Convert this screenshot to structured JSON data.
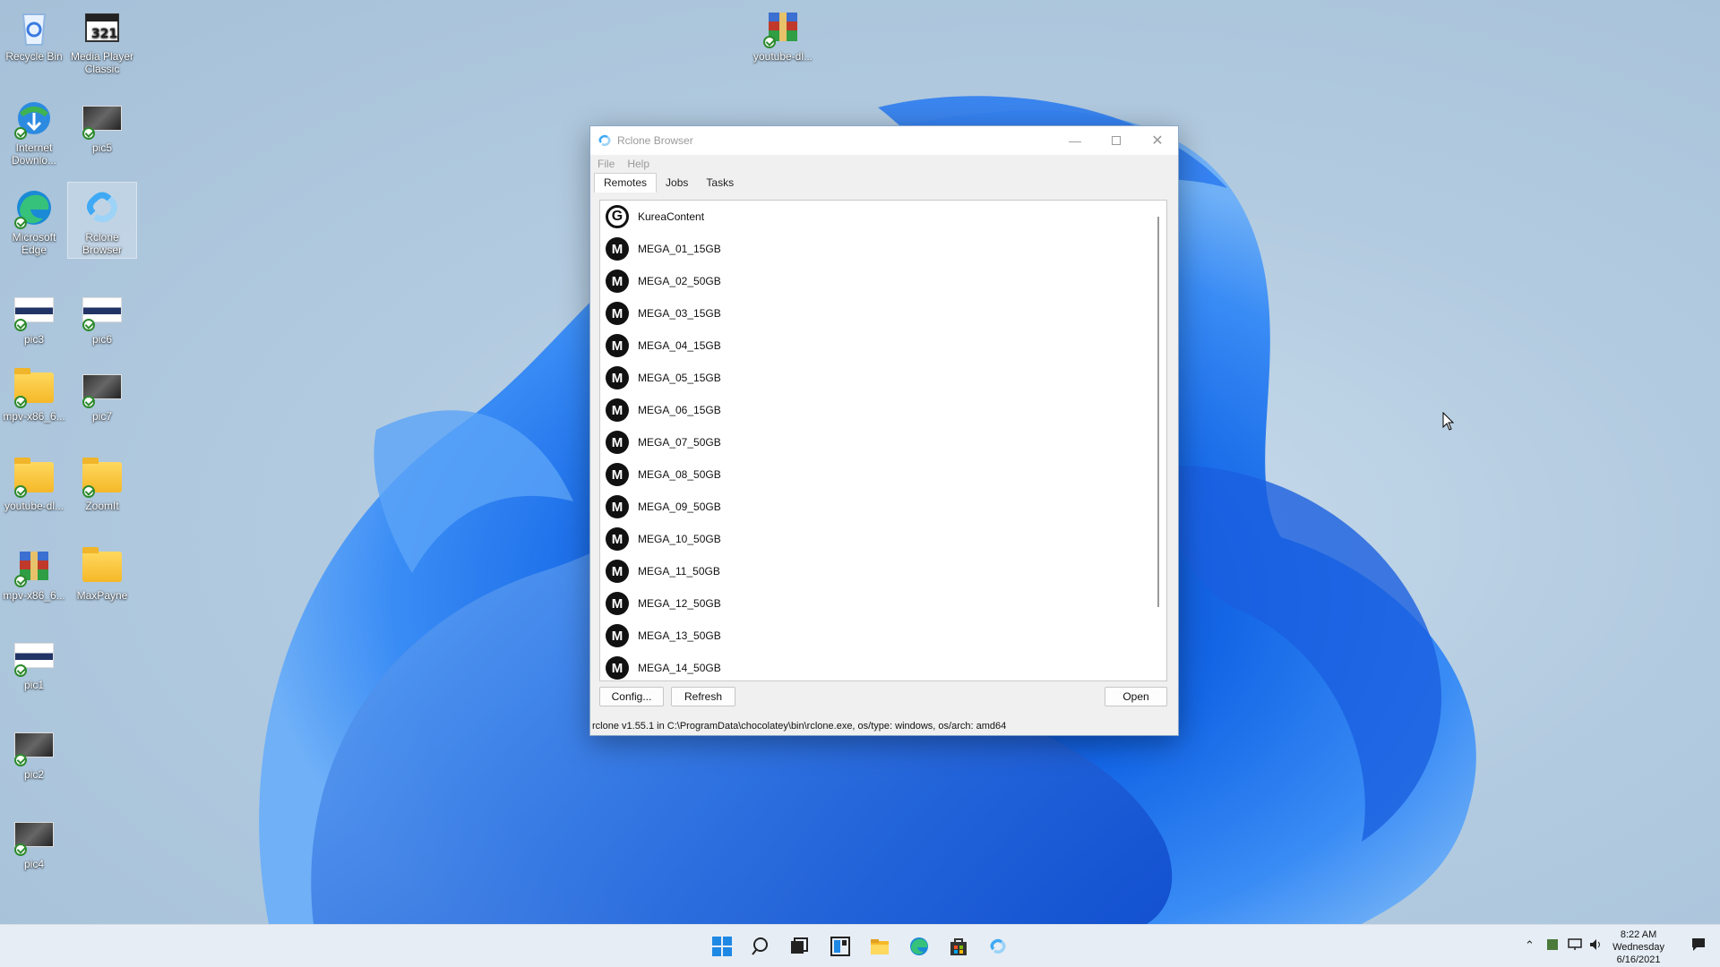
{
  "desktop": {
    "icons": [
      {
        "label": "Recycle Bin",
        "icon": "recycle-bin-icon"
      },
      {
        "label": "Media Player Classic",
        "icon": "media-player-icon"
      },
      {
        "label": "Internet Downlo...",
        "icon": "internet-download-manager-icon"
      },
      {
        "label": "pic5",
        "icon": "image-file-icon"
      },
      {
        "label": "Microsoft Edge",
        "icon": "edge-icon"
      },
      {
        "label": "Rclone Browser",
        "icon": "rclone-icon"
      },
      {
        "label": "pic3",
        "icon": "image-file-icon"
      },
      {
        "label": "pic6",
        "icon": "image-file-icon"
      },
      {
        "label": "mpv-x86_6...",
        "icon": "folder-icon"
      },
      {
        "label": "pic7",
        "icon": "image-file-icon"
      },
      {
        "label": "youtube-dl...",
        "icon": "folder-icon"
      },
      {
        "label": "ZoomIt",
        "icon": "folder-icon"
      },
      {
        "label": "mpv-x86_6...",
        "icon": "archive-icon"
      },
      {
        "label": "MaxPayne",
        "icon": "folder-icon"
      },
      {
        "label": "pic1",
        "icon": "image-file-icon"
      },
      {
        "label": "pic2",
        "icon": "image-file-icon"
      },
      {
        "label": "pic4",
        "icon": "image-file-icon"
      },
      {
        "label": "youtube-dl...",
        "icon": "archive-icon"
      }
    ]
  },
  "window": {
    "title": "Rclone Browser",
    "menu": [
      "File",
      "Help"
    ],
    "tabs": [
      "Remotes",
      "Jobs",
      "Tasks"
    ],
    "active_tab": "Remotes",
    "remotes": [
      {
        "name": "KureaContent",
        "type": "G"
      },
      {
        "name": "MEGA_01_15GB",
        "type": "M"
      },
      {
        "name": "MEGA_02_50GB",
        "type": "M"
      },
      {
        "name": "MEGA_03_15GB",
        "type": "M"
      },
      {
        "name": "MEGA_04_15GB",
        "type": "M"
      },
      {
        "name": "MEGA_05_15GB",
        "type": "M"
      },
      {
        "name": "MEGA_06_15GB",
        "type": "M"
      },
      {
        "name": "MEGA_07_50GB",
        "type": "M"
      },
      {
        "name": "MEGA_08_50GB",
        "type": "M"
      },
      {
        "name": "MEGA_09_50GB",
        "type": "M"
      },
      {
        "name": "MEGA_10_50GB",
        "type": "M"
      },
      {
        "name": "MEGA_11_50GB",
        "type": "M"
      },
      {
        "name": "MEGA_12_50GB",
        "type": "M"
      },
      {
        "name": "MEGA_13_50GB",
        "type": "M"
      },
      {
        "name": "MEGA_14_50GB",
        "type": "M"
      }
    ],
    "buttons": {
      "config": "Config...",
      "refresh": "Refresh",
      "open": "Open"
    },
    "status": "rclone v1.55.1 in C:\\ProgramData\\chocolatey\\bin\\rclone.exe, os/type: windows, os/arch: amd64"
  },
  "taskbar": {
    "apps": [
      "start-icon",
      "search-icon",
      "task-view-icon",
      "widgets-icon",
      "file-explorer-icon",
      "edge-icon",
      "store-icon",
      "rclone-icon"
    ],
    "clock": {
      "time": "8:22 AM",
      "day": "Wednesday",
      "date": "6/16/2021"
    }
  }
}
